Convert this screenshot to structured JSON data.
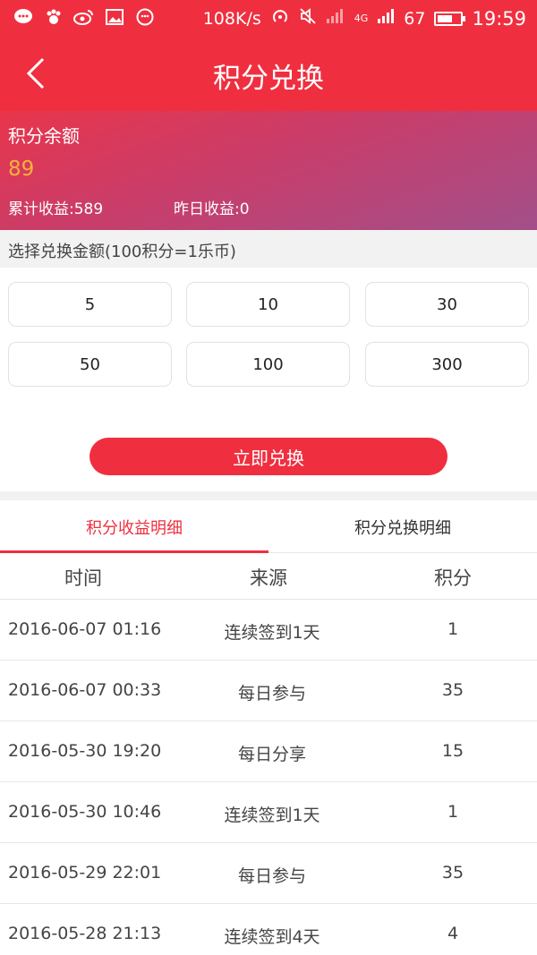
{
  "status_bar": {
    "speed": "108K/s",
    "network": "4G",
    "battery_level": "67",
    "battery_fraction": 0.67,
    "time": "19:59",
    "left_icons": [
      "chat-icon",
      "paw-icon",
      "weibo-icon",
      "image-icon",
      "emoji-icon"
    ]
  },
  "header": {
    "title": "积分兑换"
  },
  "balance": {
    "label": "积分余额",
    "value": "89",
    "total_earnings": "累计收益:589",
    "yesterday_earnings": "昨日收益:0"
  },
  "exchange": {
    "prompt": "选择兑换金额(100积分=1乐币)",
    "options": [
      "5",
      "10",
      "30",
      "50",
      "100",
      "300"
    ],
    "button_label": "立即兑换"
  },
  "tabs": [
    {
      "label": "积分收益明细",
      "active": true
    },
    {
      "label": "积分兑换明细",
      "active": false
    }
  ],
  "table": {
    "columns": [
      "时间",
      "来源",
      "积分"
    ],
    "rows": [
      {
        "time": "2016-06-07 01:16",
        "source": "连续签到1天",
        "points": "1"
      },
      {
        "time": "2016-06-07 00:33",
        "source": "每日参与",
        "points": "35"
      },
      {
        "time": "2016-05-30 19:20",
        "source": "每日分享",
        "points": "15"
      },
      {
        "time": "2016-05-30 10:46",
        "source": "连续签到1天",
        "points": "1"
      },
      {
        "time": "2016-05-29 22:01",
        "source": "每日参与",
        "points": "35"
      },
      {
        "time": "2016-05-28 21:13",
        "source": "连续签到4天",
        "points": "4"
      }
    ]
  },
  "colors": {
    "primary": "#ef2f3f",
    "balance_value": "#f5b13e",
    "gradient_end": "#a24f8a"
  }
}
